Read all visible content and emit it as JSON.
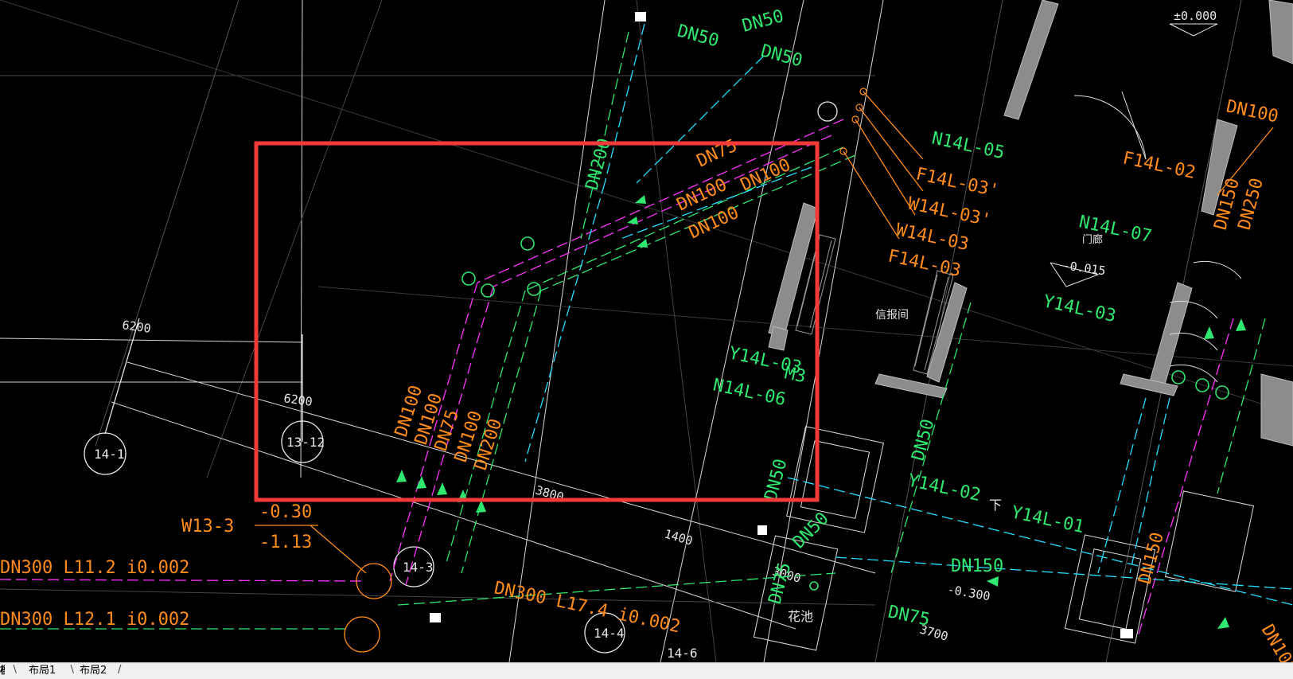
{
  "tabs": {
    "model": "模型",
    "layout1": "布局1",
    "layout2": "布局2"
  },
  "drawing": {
    "dims": [
      "6200",
      "6200",
      "3800",
      "1400",
      "3000",
      "3700"
    ],
    "axis_bubbles": [
      "14-1",
      "13-12",
      "14-3",
      "14-4",
      "14-6"
    ],
    "pipe_sizes": {
      "dn50": "DN50",
      "dn75": "DN75",
      "dn100": "DN100",
      "dn150": "DN150",
      "dn200": "DN200",
      "dn250": "DN250"
    },
    "pipe_runs": [
      "DN300  L11.2  i0.002",
      "DN300  L12.1  i0.002",
      "DN300  L17.4  i0.002"
    ],
    "riser_tags": [
      "N14L-05",
      "F14L-03'",
      "W14L-03'",
      "W14L-03",
      "F14L-03",
      "N14L-07",
      "Y14L-03",
      "Y14L-02",
      "Y14L-01",
      "N14L-06",
      "F14L-02"
    ],
    "elev": [
      "±0.000",
      "-0.015",
      "-0.300",
      "-0.30",
      "-1.13"
    ],
    "well_tag": "W13-3",
    "room_labels": [
      "信报间",
      "门廊",
      "花池"
    ],
    "door_mark": "M3",
    "downstair": "下"
  },
  "colors": {
    "dim_white": "#e8e8e8",
    "orange": "#ff8c1a",
    "green": "#2ee870",
    "teal": "#22d0a0",
    "magenta": "#ff33ff",
    "cyan": "#22e0ff",
    "gray_wall": "#8c8c8c",
    "highlight_red": "#f23a3a",
    "grid_gray": "#5a5a5a"
  }
}
